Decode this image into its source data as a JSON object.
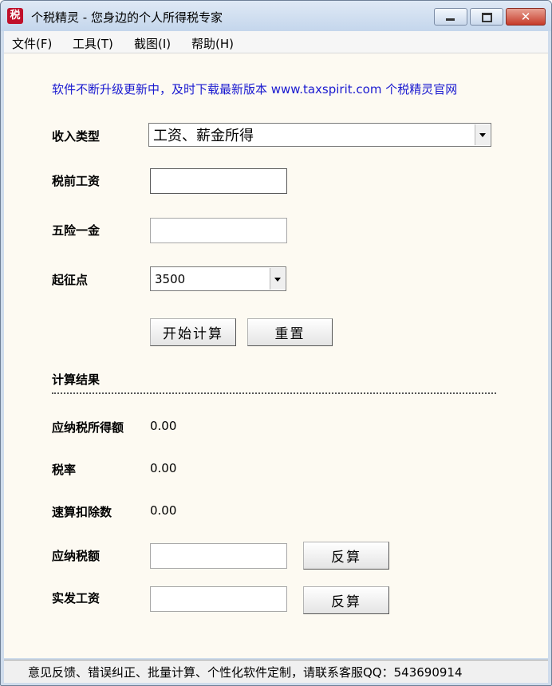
{
  "window": {
    "title": "个税精灵 - 您身边的个人所得税专家",
    "icon_glyph": "税"
  },
  "menu": [
    "文件(F)",
    "工具(T)",
    "截图(I)",
    "帮助(H)"
  ],
  "notice": "软件不断升级更新中，及时下载最新版本 www.taxspirit.com 个税精灵官网",
  "form": {
    "income_type_label": "收入类型",
    "income_type_value": "工资、薪金所得",
    "pretax_salary_label": "税前工资",
    "pretax_salary_value": "",
    "insurance_label": "五险一金",
    "insurance_value": "",
    "threshold_label": "起征点",
    "threshold_value": "3500",
    "calculate_button": "开始计算",
    "reset_button": "重置"
  },
  "results": {
    "section_title": "计算结果",
    "taxable_income_label": "应纳税所得额",
    "taxable_income_value": "0.00",
    "tax_rate_label": "税率",
    "tax_rate_value": "0.00",
    "quick_deduction_label": "速算扣除数",
    "quick_deduction_value": "0.00",
    "tax_payable_label": "应纳税额",
    "tax_payable_value": "",
    "net_salary_label": "实发工资",
    "net_salary_value": "",
    "reverse_button": "反算"
  },
  "status": "意见反馈、错误纠正、批量计算、个性化软件定制，请联系客服QQ：543690914",
  "colors": {
    "notice_text": "#1a1ad0",
    "client_bg": "#fdfaf2",
    "titlebar": "#c4d6ec"
  }
}
